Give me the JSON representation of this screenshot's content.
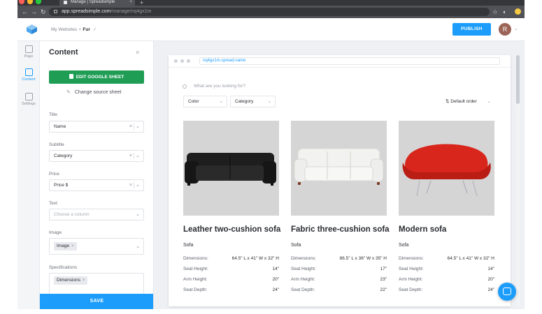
{
  "browser": {
    "tab_title": "Manage | Spreadsimple",
    "url_host": "app.spreadsimple.com",
    "url_path": "/manage/nq4gx1m",
    "newtab_symbol": "+",
    "close_symbol": "×"
  },
  "header": {
    "breadcrumb_root": "My Websites",
    "breadcrumb_sep": "•",
    "breadcrumb_current": "Fur",
    "publish_label": "PUBLISH",
    "avatar_letter": "R"
  },
  "rail": {
    "items": [
      {
        "label": "Page"
      },
      {
        "label": "Content"
      },
      {
        "label": "Settings"
      }
    ]
  },
  "panel": {
    "title": "Content",
    "edit_sheet_label": "EDIT GOOGLE SHEET",
    "change_source_label": "Change source sheet",
    "fields": {
      "title": {
        "label": "Title",
        "value": "Name"
      },
      "subtitle": {
        "label": "Subtitle",
        "value": "Category"
      },
      "price": {
        "label": "Price",
        "value": "Price $"
      },
      "text": {
        "label": "Text",
        "placeholder": "Choose a column"
      },
      "image": {
        "label": "Image",
        "chip": "Image"
      },
      "specifications": {
        "label": "Specifications",
        "chip": "Dimensions"
      }
    },
    "save_label": "SAVE"
  },
  "preview": {
    "url": "nq4gx1m.spread.name",
    "search_placeholder": "What are you looking for?",
    "filters": {
      "color": "Color",
      "category": "Category",
      "sort": "Default order"
    },
    "cards": [
      {
        "title": "Leather two-cushion sofa",
        "category": "Sofa",
        "specs": [
          {
            "label": "Dimensions:",
            "value": "64.5\" L x 41\" W x 32\" H"
          },
          {
            "label": "Seat Height:",
            "value": "14\""
          },
          {
            "label": "Arm Height:",
            "value": "20\""
          },
          {
            "label": "Seat Depth:",
            "value": "24\""
          }
        ]
      },
      {
        "title": "Fabric three-cushion sofa",
        "category": "Sofa",
        "specs": [
          {
            "label": "Dimensions:",
            "value": "86.5\" L x 36\" W x 35\" H"
          },
          {
            "label": "Seat Height:",
            "value": "17\""
          },
          {
            "label": "Arm Height:",
            "value": "23\""
          },
          {
            "label": "Seat Depth:",
            "value": "22\""
          }
        ]
      },
      {
        "title": "Modern sofa",
        "category": "Sofa",
        "specs": [
          {
            "label": "Dimensions:",
            "value": "64.5\" L x 41\" W x 32\" H"
          },
          {
            "label": "Seat Height:",
            "value": "14\""
          },
          {
            "label": "Arm Height:",
            "value": "20\""
          },
          {
            "label": "Seat Depth:",
            "value": "24\""
          }
        ]
      }
    ]
  },
  "colors": {
    "accent": "#1c9dfb",
    "sheet_green": "#1f9d55",
    "leather": "#1e1e1e",
    "fabric": "#f2f2f0",
    "modern": "#d8261c"
  }
}
